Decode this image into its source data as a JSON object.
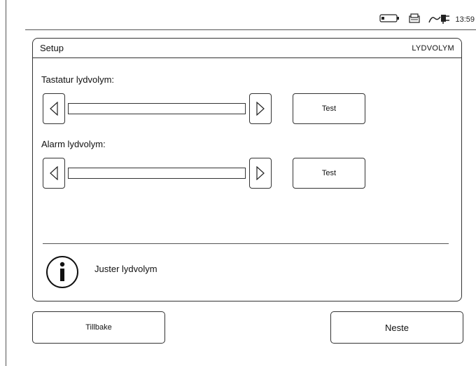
{
  "status_bar": {
    "time": "13:59",
    "icons": [
      "battery-icon",
      "printer-icon",
      "power-plug-icon"
    ]
  },
  "panel": {
    "title": "Setup",
    "subtitle": "LYDVOLYM"
  },
  "keyboard_volume": {
    "label": "Tastatur lydvolym:",
    "level": 0,
    "test_label": "Test"
  },
  "alarm_volume": {
    "label": "Alarm lydvolym:",
    "level": 0,
    "test_label": "Test"
  },
  "info": {
    "icon": "info-icon",
    "text": "Juster lydvolym"
  },
  "footer": {
    "back_label": "Tillbake",
    "next_label": "Neste"
  }
}
